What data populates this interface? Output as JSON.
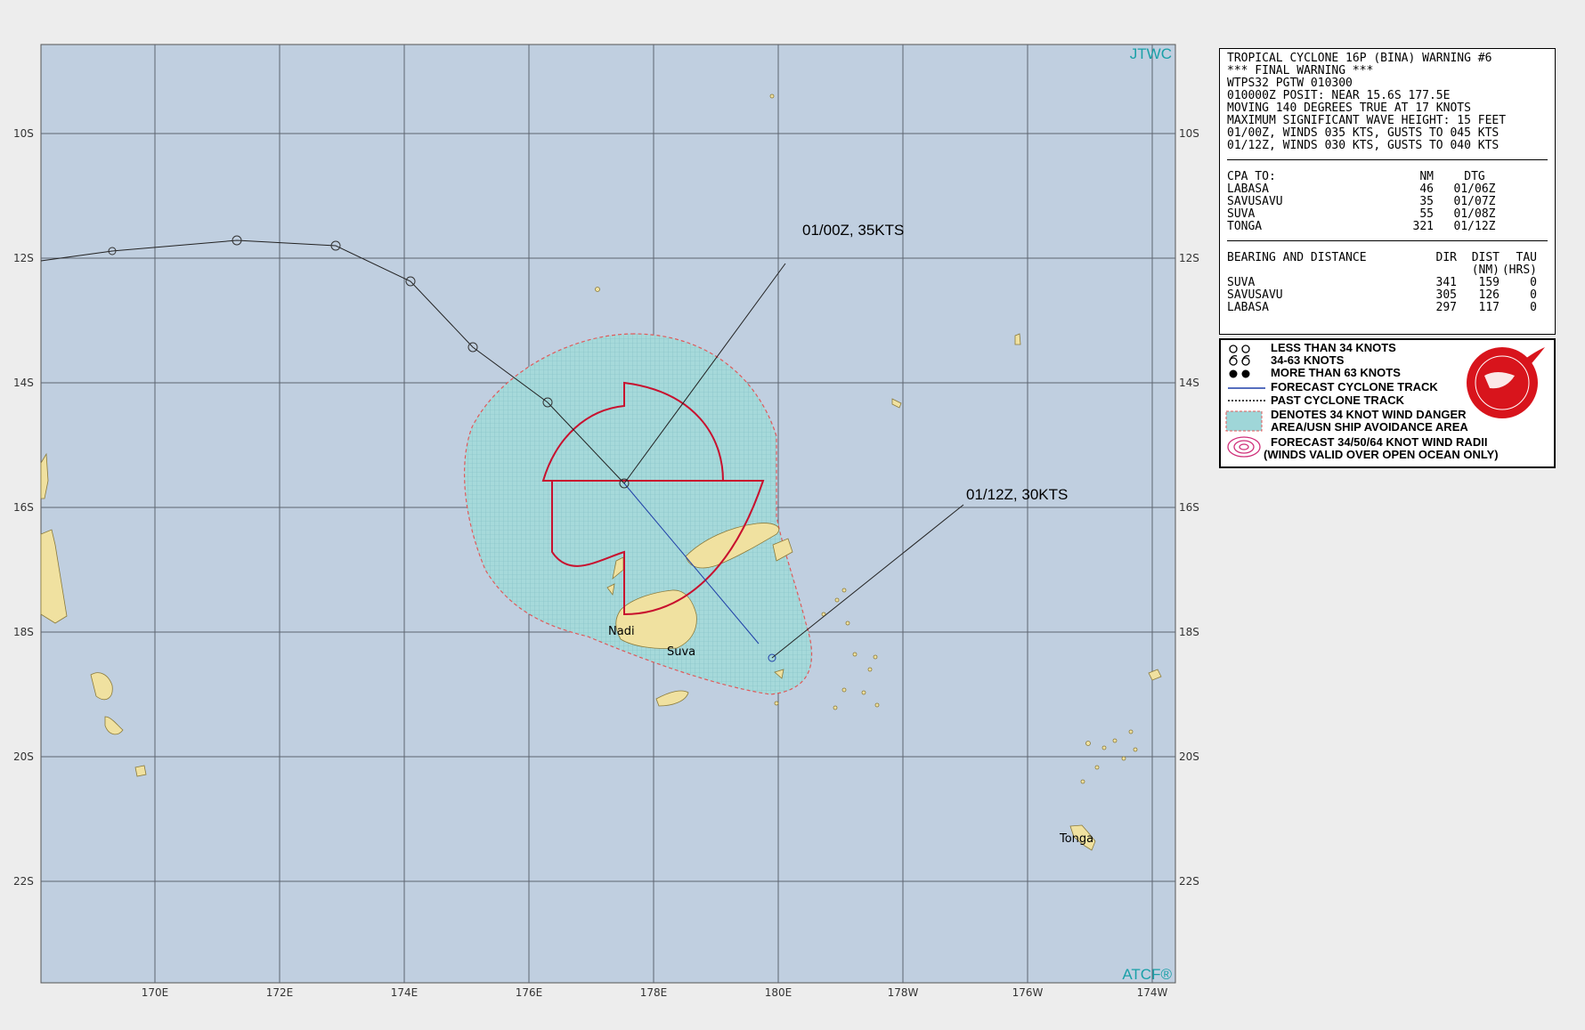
{
  "map": {
    "credit_top": "JTWC",
    "credit_bottom": "ATCF®",
    "lat_labels": [
      "10S",
      "12S",
      "14S",
      "16S",
      "18S",
      "20S",
      "22S"
    ],
    "lon_labels": [
      "170E",
      "172E",
      "174E",
      "176E",
      "178E",
      "180E",
      "178W",
      "176W",
      "174W"
    ],
    "colors": {
      "ocean": "#c0cfe0",
      "land": "#f0e1a0",
      "danger_fill": "#9fd6d8",
      "danger_edge": "#e05a5a",
      "radii": "#c8102e",
      "forecast_track": "#1f3fa8"
    },
    "places": {
      "nadi": "Nadi",
      "suva": "Suva",
      "tonga": "Tonga"
    },
    "annotations": {
      "current": "01/00Z,  35KTS",
      "forecast": "01/12Z,  30KTS"
    }
  },
  "warning": {
    "lines": [
      "TROPICAL CYCLONE 16P (BINA) WARNING #6",
      "*** FINAL WARNING ***",
      "WTPS32 PGTW 010300",
      "010000Z POSIT: NEAR 15.6S 177.5E",
      "MOVING 140 DEGREES TRUE AT 17 KNOTS",
      "MAXIMUM SIGNIFICANT WAVE HEIGHT: 15 FEET",
      "01/00Z, WINDS 035 KTS, GUSTS TO 045 KTS",
      "01/12Z, WINDS 030 KTS, GUSTS TO 040 KTS"
    ],
    "cpa": {
      "header": [
        "CPA TO:",
        "NM",
        "DTG"
      ],
      "rows": [
        [
          "LABASA",
          "46",
          "01/06Z"
        ],
        [
          "SAVUSAVU",
          "35",
          "01/07Z"
        ],
        [
          "SUVA",
          "55",
          "01/08Z"
        ],
        [
          "TONGA",
          "321",
          "01/12Z"
        ]
      ]
    },
    "bearing": {
      "header1": [
        "BEARING AND DISTANCE",
        "DIR",
        "DIST",
        "TAU"
      ],
      "header2": [
        "",
        "",
        "(NM)",
        "(HRS)"
      ],
      "rows": [
        [
          "SUVA",
          "341",
          "159",
          "0"
        ],
        [
          "SAVUSAVU",
          "305",
          "126",
          "0"
        ],
        [
          "LABASA",
          "297",
          "117",
          "0"
        ]
      ]
    }
  },
  "legend": {
    "items": [
      "LESS THAN 34 KNOTS",
      "34-63 KNOTS",
      "MORE THAN 63 KNOTS",
      "FORECAST CYCLONE TRACK",
      "PAST CYCLONE TRACK",
      "DENOTES 34 KNOT WIND DANGER",
      "AREA/USN SHIP AVOIDANCE AREA",
      "FORECAST 34/50/64 KNOT WIND RADII",
      "(WINDS VALID OVER OPEN OCEAN ONLY)"
    ],
    "logo_icon": "joint-typhoon-warning-center-seal"
  }
}
